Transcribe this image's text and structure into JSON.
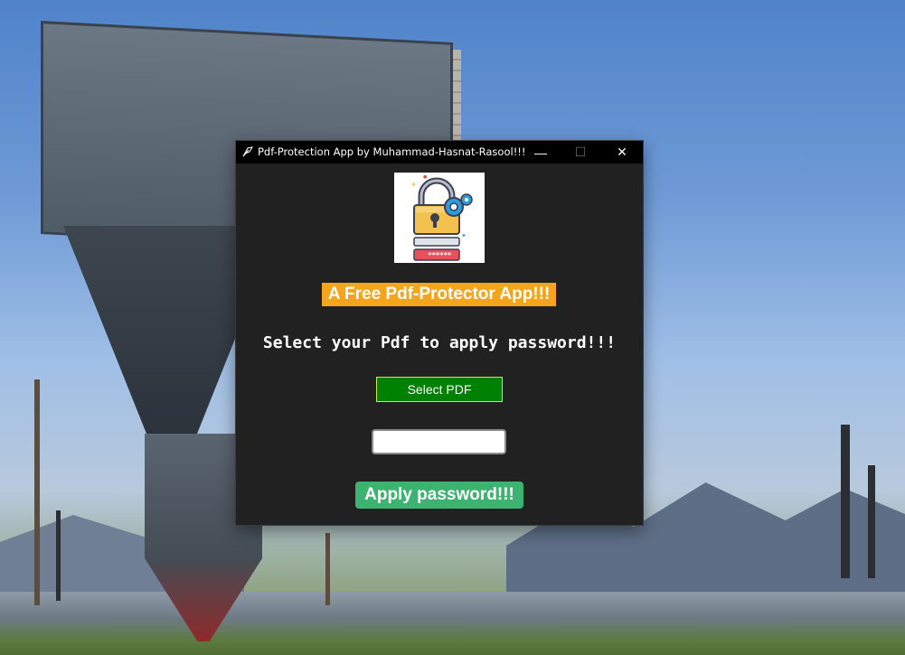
{
  "window": {
    "title": "Pdf-Protection App by Muhammad-Hasnat-Rasool!!!",
    "controls": {
      "minimize": "—",
      "maximize": "☐",
      "close": "✕"
    }
  },
  "logo": {
    "icon": "padlock-with-gear-and-password-field-icon",
    "password_mask": "******"
  },
  "banner": {
    "text": "A Free Pdf-Protector App!!!"
  },
  "instruction": {
    "text": "Select your Pdf to apply password!!!"
  },
  "select_button": {
    "label": "Select PDF"
  },
  "password_input": {
    "value": "",
    "placeholder": ""
  },
  "apply_button": {
    "label": "Apply password!!!"
  },
  "colors": {
    "window_bg": "#212121",
    "title_bar": "#000000",
    "banner_bg": "#f5a51b",
    "select_button_bg": "#008000",
    "apply_button_bg": "#3cb371"
  }
}
